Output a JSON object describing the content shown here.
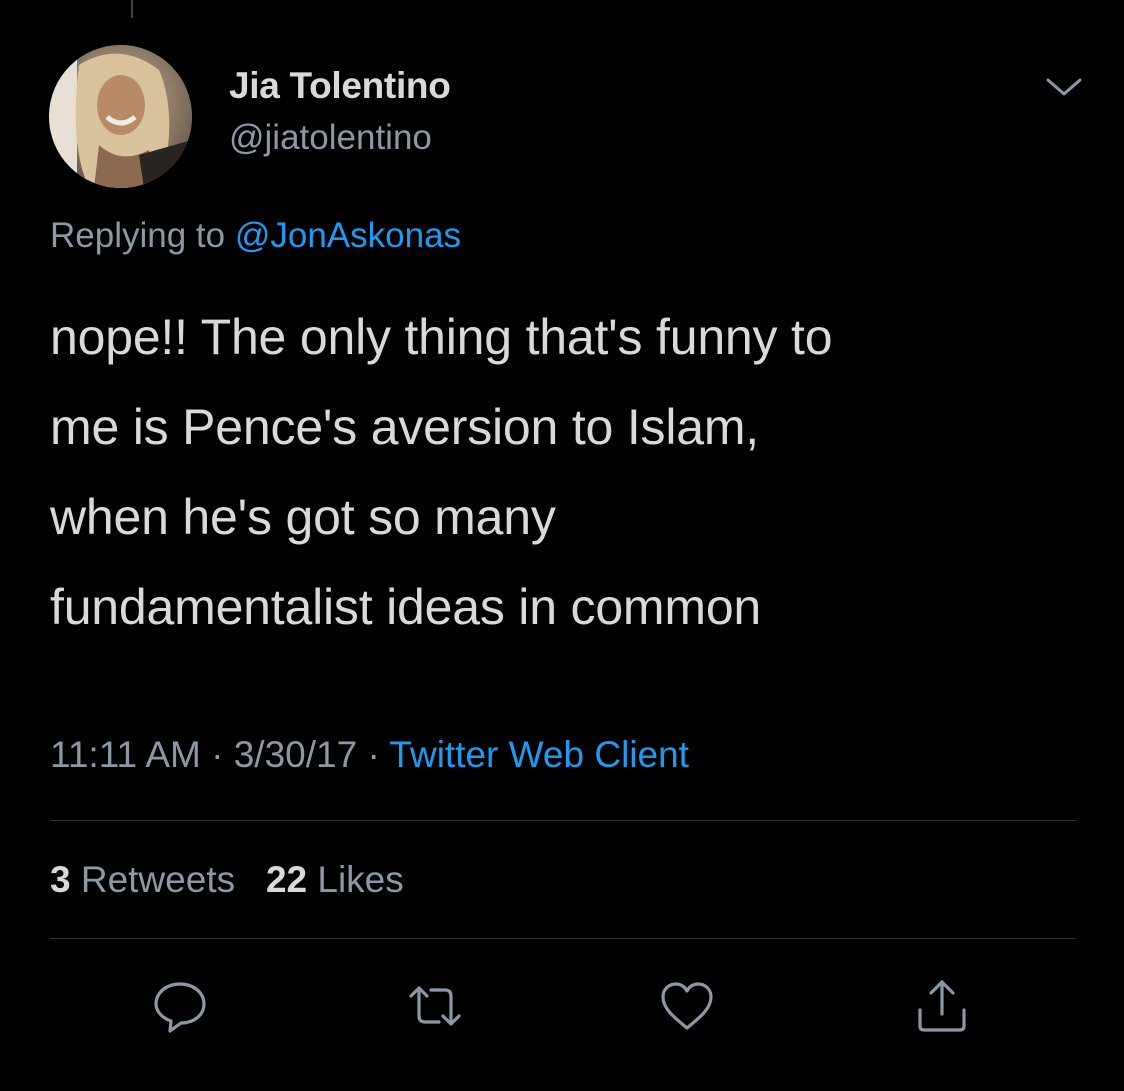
{
  "author": {
    "name": "Jia Tolentino",
    "handle": "@jiatolentino"
  },
  "reply": {
    "prefix": "Replying to",
    "mention": "@JonAskonas"
  },
  "tweet": {
    "lines": [
      "nope!! The only thing that's funny to",
      "me is Pence's aversion to Islam,",
      "when he's got so many",
      "fundamentalist ideas in common"
    ]
  },
  "meta": {
    "time": "11:11 AM",
    "separator": "·",
    "date": "3/30/17",
    "source": "Twitter Web Client"
  },
  "stats": {
    "retweets_count": "3",
    "retweets_label": "Retweets",
    "likes_count": "22",
    "likes_label": "Likes"
  },
  "icons": {
    "more": "chevron-down-icon",
    "reply": "comment-bubble-icon",
    "retweet": "retweet-icon",
    "like": "heart-icon",
    "share": "share-icon"
  },
  "colors": {
    "background": "#000000",
    "text_primary": "#d9d9d9",
    "text_secondary": "#8b98a5",
    "accent": "#1d9bf0",
    "divider": "#2f3336"
  }
}
